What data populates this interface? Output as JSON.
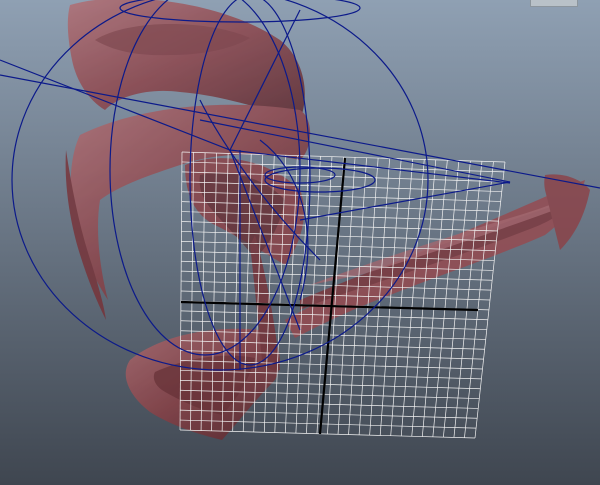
{
  "viewport": {
    "background_top": "#8fa0b3",
    "background_bottom": "#3f4650"
  },
  "surface": {
    "color": "#8e3f44",
    "highlight": "#b66c70",
    "shadow": "#5a2226"
  },
  "wireframe": {
    "color": "#0c1a8a"
  },
  "grid": {
    "color": "#f2f2f2",
    "axis_color": "#000000"
  }
}
